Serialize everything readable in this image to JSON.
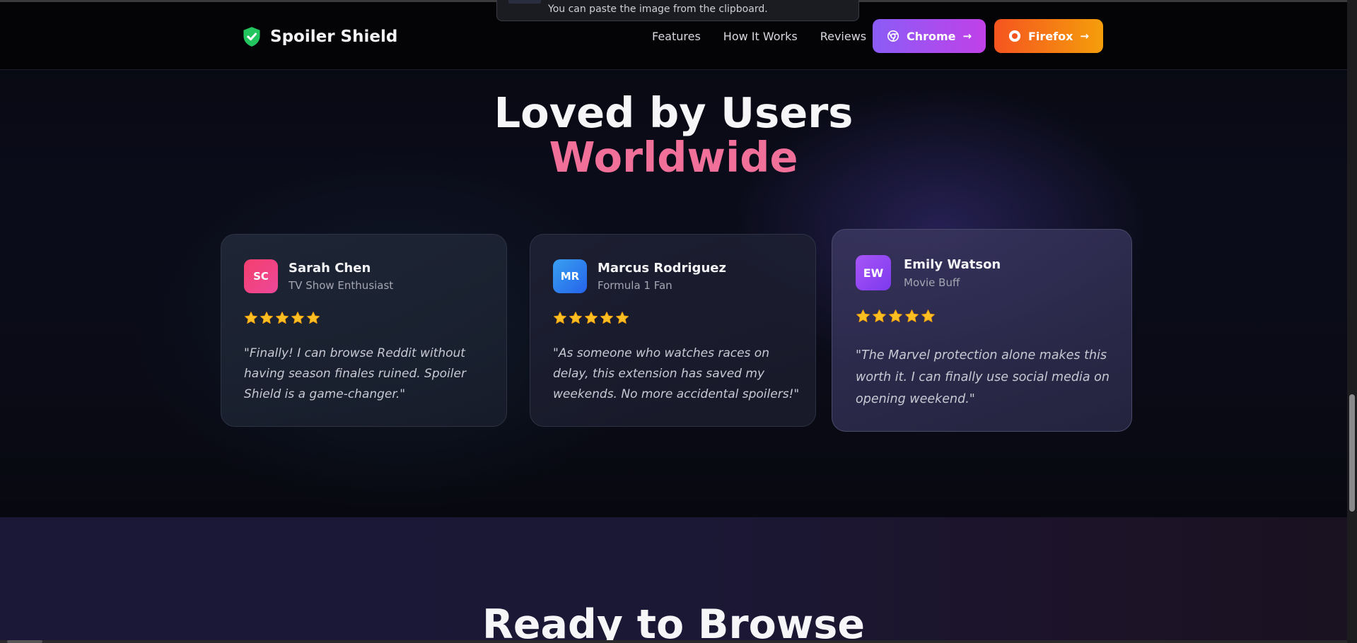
{
  "toast": {
    "text": "You can paste the image from the clipboard."
  },
  "navbar": {
    "brand": "Spoiler Shield",
    "brand_icon": "shield-check-icon",
    "links": [
      "Features",
      "How It Works",
      "Reviews"
    ],
    "chrome_button": "Chrome",
    "firefox_button": "Firefox"
  },
  "colors": {
    "accent_pink": "#f0709a",
    "chrome_gradient": [
      "#8b5cf6",
      "#c041e8"
    ],
    "firefox_gradient": [
      "#f5541f",
      "#f59e0b"
    ],
    "star": "#fbbf24"
  },
  "reviews": {
    "heading_line1": "Loved by Users",
    "heading_line2": "Worldwide",
    "items": [
      {
        "initials": "SC",
        "name": "Sarah Chen",
        "role": "TV Show Enthusiast",
        "rating": 5,
        "quote": "\"Finally! I can browse Reddit without having season finales ruined. Spoiler Shield is a game-changer.\""
      },
      {
        "initials": "MR",
        "name": "Marcus Rodriguez",
        "role": "Formula 1 Fan",
        "rating": 5,
        "quote": "\"As someone who watches races on delay, this extension has saved my weekends. No more accidental spoilers!\""
      },
      {
        "initials": "EW",
        "name": "Emily Watson",
        "role": "Movie Buff",
        "rating": 5,
        "quote": "\"The Marvel protection alone makes this worth it. I can finally use social media on opening weekend.\""
      }
    ]
  },
  "cta": {
    "heading": "Ready to Browse"
  }
}
